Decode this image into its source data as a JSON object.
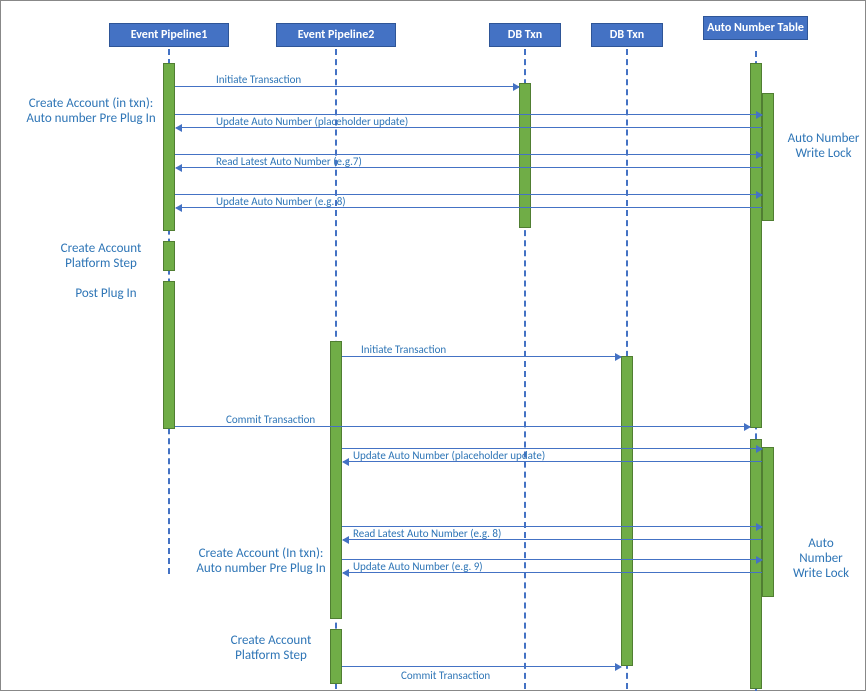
{
  "participants": {
    "p1": "Event Pipeline1",
    "p2": "Event Pipeline2",
    "p3": "DB Txn",
    "p4": "DB Txn",
    "p5": "Auto Number Table"
  },
  "messages": {
    "m1": "Initiate Transaction",
    "m2": "Update Auto Number (placeholder update)",
    "m3": "Read Latest Auto Number (e.g.7)",
    "m4": "Update Auto Number (e.g. 8)",
    "m5": "Initiate Transaction",
    "m6": "Commit Transaction",
    "m7": "Update Auto Number (placeholder update)",
    "m8": "Read Latest Auto Number (e.g. 8)",
    "m9": "Update Auto Number (e.g. 9)",
    "m10": "Commit Transaction"
  },
  "sideLabels": {
    "s1": "Create Account (in txn): Auto number Pre Plug In",
    "s2": "Create Account Platform Step",
    "s3": "Post Plug In",
    "s4": "Auto Number Write Lock",
    "s5": "Create Account (In txn): Auto number Pre Plug In",
    "s6": "Create Account Platform Step",
    "s7": "Auto Number Write Lock"
  },
  "chart_data": {
    "type": "sequence",
    "participants": [
      "Event Pipeline1",
      "Event Pipeline2",
      "DB Txn",
      "DB Txn",
      "Auto Number Table"
    ],
    "messages": [
      {
        "from": "Event Pipeline1",
        "to": "DB Txn",
        "label": "Initiate Transaction"
      },
      {
        "from": "Auto Number Table",
        "to": "Event Pipeline1",
        "label": "Update Auto Number (placeholder update)"
      },
      {
        "from": "Auto Number Table",
        "to": "Event Pipeline1",
        "label": "Read Latest Auto Number (e.g.7)"
      },
      {
        "from": "Auto Number Table",
        "to": "Event Pipeline1",
        "label": "Update Auto Number (e.g. 8)"
      },
      {
        "from": "Event Pipeline2",
        "to": "DB Txn (2)",
        "label": "Initiate Transaction"
      },
      {
        "from": "Event Pipeline1",
        "to": "Auto Number Table",
        "label": "Commit Transaction"
      },
      {
        "from": "Auto Number Table",
        "to": "Event Pipeline2",
        "label": "Update Auto Number (placeholder update)"
      },
      {
        "from": "Auto Number Table",
        "to": "Event Pipeline2",
        "label": "Read Latest Auto Number (e.g. 8)"
      },
      {
        "from": "Auto Number Table",
        "to": "Event Pipeline2",
        "label": "Update Auto Number (e.g. 9)"
      },
      {
        "from": "Event Pipeline2",
        "to": "DB Txn (2)",
        "label": "Commit Transaction"
      }
    ],
    "annotations": [
      "Create Account (in txn): Auto number Pre Plug In",
      "Create Account Platform Step",
      "Post Plug In",
      "Auto Number Write Lock",
      "Create Account (In txn): Auto number Pre Plug In",
      "Create Account Platform Step",
      "Auto Number Write Lock"
    ]
  }
}
